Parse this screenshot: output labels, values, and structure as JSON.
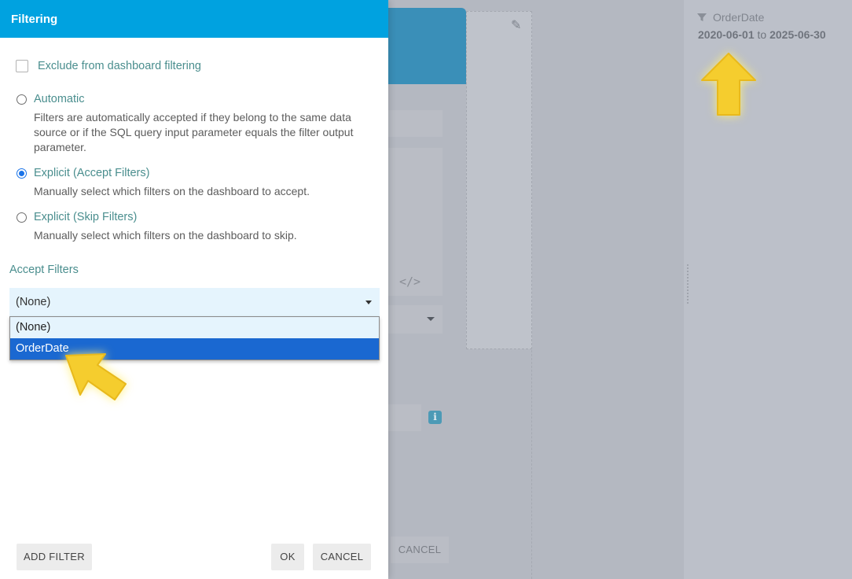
{
  "modal": {
    "title": "Filtering",
    "exclude_label": "Exclude from dashboard filtering",
    "options": [
      {
        "label": "Automatic",
        "description": "Filters are automatically accepted if they belong to the same data source or if the SQL query input parameter equals the filter output parameter.",
        "checked": false
      },
      {
        "label": "Explicit (Accept Filters)",
        "description": "Manually select which filters on the dashboard to accept.",
        "checked": true
      },
      {
        "label": "Explicit (Skip Filters)",
        "description": "Manually select which filters on the dashboard to skip.",
        "checked": false
      }
    ],
    "accept_filters_label": "Accept Filters",
    "select_value": "(None)",
    "dropdown_items": [
      "(None)",
      "OrderDate"
    ],
    "dropdown_selected": "OrderDate",
    "buttons": {
      "add_filter": "ADD FILTER",
      "ok": "OK",
      "cancel": "CANCEL"
    }
  },
  "background": {
    "editor_cancel": "CANCEL",
    "code_icon": "code-icon",
    "info_icon": "info-icon",
    "filter": {
      "name": "OrderDate",
      "range_start": "2020-06-01",
      "range_sep": "to",
      "range_end": "2025-06-30"
    }
  },
  "colors": {
    "header": "#00a2e0",
    "accent_text": "#4a8e8e",
    "selected_item": "#1a68d1",
    "arrow": "#f5cd2e"
  }
}
